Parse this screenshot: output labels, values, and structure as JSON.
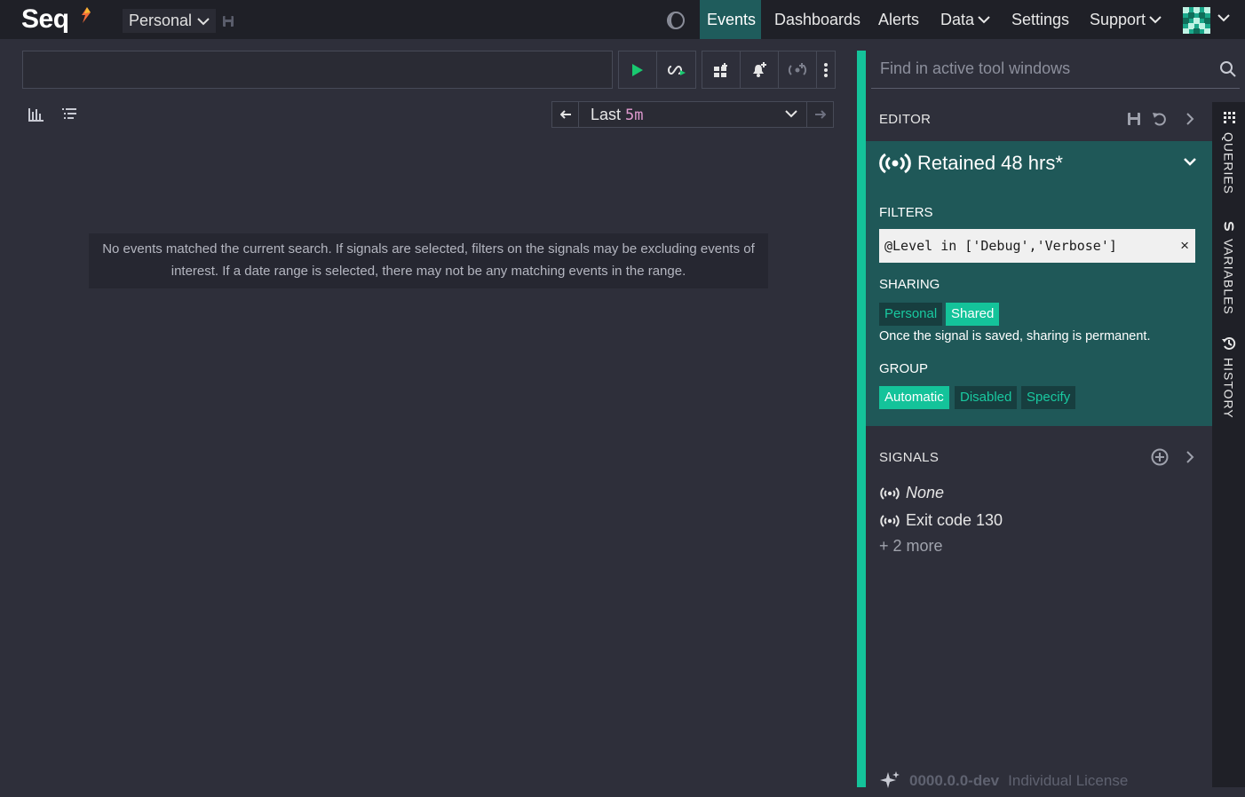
{
  "app": {
    "logo": "Seq",
    "workspace": "Personal"
  },
  "nav": {
    "events": "Events",
    "dashboards": "Dashboards",
    "alerts": "Alerts",
    "data": "Data",
    "settings": "Settings",
    "support": "Support"
  },
  "toolbar": {
    "range_label": "Last",
    "range_value": "5m"
  },
  "results": {
    "empty_message": "No events matched the current search. If signals are selected, filters on the signals may be excluding events of interest. If a date range is selected, there may not be any matching events in the range."
  },
  "panel": {
    "find_placeholder": "Find in active tool windows",
    "editor_title": "EDITOR",
    "signal_name": "Retained 48 hrs*",
    "filters_title": "FILTERS",
    "filter_value": "@Level in ['Debug','Verbose']",
    "filter_clear": "×",
    "sharing_title": "SHARING",
    "sharing_options": [
      "Personal",
      "Shared"
    ],
    "sharing_selected": "Shared",
    "sharing_note": "Once the signal is saved, sharing is permanent.",
    "group_title": "GROUP",
    "group_options": [
      "Automatic",
      "Disabled",
      "Specify"
    ],
    "group_selected": "Automatic",
    "signals_title": "SIGNALS",
    "signals": [
      "None",
      "Exit code 130"
    ],
    "more": "+ 2 more"
  },
  "side_tabs": {
    "queries": "QUERIES",
    "variables": "VARIABLES",
    "history": "HISTORY"
  },
  "footer": {
    "version": "0000.0.0-dev",
    "license": "Individual License"
  },
  "colors": {
    "accent": "#14c39a",
    "card_bg": "#1f5858",
    "topbar_bg": "#1f2027",
    "page_bg": "#2e2f3a"
  }
}
